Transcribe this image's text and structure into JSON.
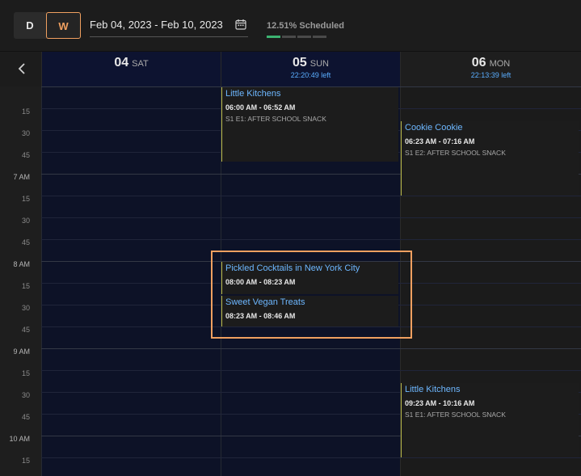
{
  "toolbar": {
    "view_day": "D",
    "view_week": "W",
    "date_range": "Feb 04, 2023 - Feb 10, 2023",
    "scheduled": "12.51% Scheduled",
    "scheduled_fraction": 0.1251
  },
  "days": [
    {
      "num": "04",
      "dow": "SAT",
      "left": ""
    },
    {
      "num": "05",
      "dow": "SUN",
      "left": "22:20:49 left"
    },
    {
      "num": "06",
      "dow": "MON",
      "left": "22:13:39 left"
    }
  ],
  "time_labels": [
    "15",
    "30",
    "45",
    "7 AM",
    "15",
    "30",
    "45",
    "8 AM",
    "15",
    "30",
    "45",
    "9 AM",
    "15",
    "30",
    "45",
    "10 AM",
    "15"
  ],
  "events": [
    {
      "title": "Little Kitchens",
      "time": "06:00 AM - 06:52 AM",
      "sub": "S1 E1: AFTER SCHOOL SNACK"
    },
    {
      "title": "Cookie Cookie",
      "time": "06:23 AM - 07:16 AM",
      "sub": "S1 E2: AFTER SCHOOL SNACK"
    },
    {
      "title": "Pickled Cocktails in New York City",
      "time": "08:00 AM - 08:23 AM",
      "sub": ""
    },
    {
      "title": "Sweet Vegan Treats",
      "time": "08:23 AM - 08:46 AM",
      "sub": ""
    },
    {
      "title": "Little Kitchens",
      "time": "09:23 AM - 10:16 AM",
      "sub": "S1 E1: AFTER SCHOOL SNACK"
    }
  ],
  "colors": {
    "accent": "#f0a060",
    "link": "#6db7ff",
    "progress": "#3cb371"
  }
}
